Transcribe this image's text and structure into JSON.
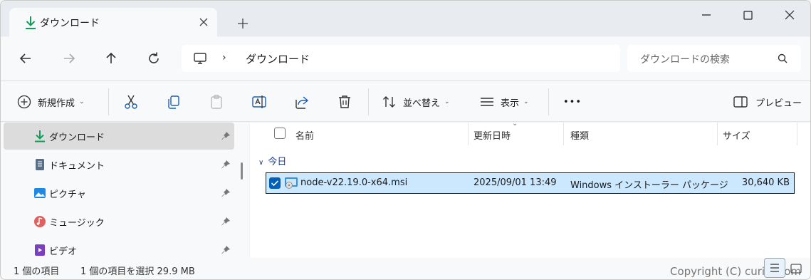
{
  "tab": {
    "title": "ダウンロード"
  },
  "address": {
    "crumb": "ダウンロード",
    "separator": "›"
  },
  "search": {
    "placeholder": "ダウンロードの検索"
  },
  "toolbar": {
    "new_label": "新規作成",
    "sort_label": "並べ替え",
    "view_label": "表示",
    "more_label": "•••",
    "preview_label": "プレビュー"
  },
  "sidebar": {
    "items": [
      {
        "label": "ダウンロード",
        "icon": "download-icon"
      },
      {
        "label": "ドキュメント",
        "icon": "document-icon"
      },
      {
        "label": "ピクチャ",
        "icon": "picture-icon"
      },
      {
        "label": "ミュージック",
        "icon": "music-icon"
      },
      {
        "label": "ビデオ",
        "icon": "video-icon"
      }
    ]
  },
  "columns": {
    "name": "名前",
    "date": "更新日時",
    "type": "種類",
    "size": "サイズ"
  },
  "group": {
    "label": "今日"
  },
  "files": [
    {
      "name": "node-v22.19.0-x64.msi",
      "date": "2025/09/01 13:49",
      "type": "Windows インストーラー パッケージ",
      "size": "30,640 KB"
    }
  ],
  "status": {
    "count": "1 個の項目",
    "selection": "1 個の項目を選択  29.9 MB"
  },
  "watermark": "Copyright (C) curict.com",
  "colors": {
    "accent": "#005fb8",
    "selection": "#cce8ff",
    "download_green": "#0f9d58"
  }
}
